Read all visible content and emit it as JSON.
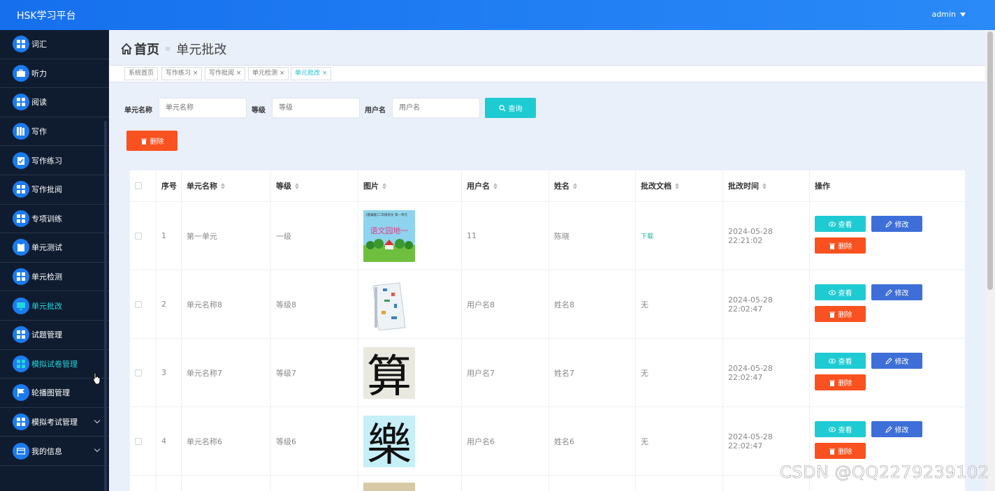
{
  "header": {
    "brand": "HSK学习平台",
    "user": "admin"
  },
  "sidebar": {
    "items": [
      {
        "label": "词汇",
        "icon": "grid-icon"
      },
      {
        "label": "听力",
        "icon": "briefcase-icon"
      },
      {
        "label": "阅读",
        "icon": "grid-icon"
      },
      {
        "label": "写作",
        "icon": "book-icon"
      },
      {
        "label": "写作练习",
        "icon": "clipboard-check-icon"
      },
      {
        "label": "写作批阅",
        "icon": "grid-icon"
      },
      {
        "label": "专项训练",
        "icon": "grid-icon"
      },
      {
        "label": "单元测试",
        "icon": "clipboard-icon"
      },
      {
        "label": "单元检测",
        "icon": "grid-icon"
      },
      {
        "label": "单元批改",
        "icon": "monitor-icon"
      },
      {
        "label": "试题管理",
        "icon": "grid-icon"
      },
      {
        "label": "模拟试卷管理",
        "icon": "grid-icon"
      },
      {
        "label": "轮播图管理",
        "icon": "flag-icon"
      },
      {
        "label": "模拟考试管理",
        "icon": "grid-icon"
      },
      {
        "label": "我的信息",
        "icon": "id-card-icon"
      }
    ]
  },
  "breadcrumb": {
    "home": "首页",
    "current": "单元批改"
  },
  "tags": [
    {
      "label": "系统首页",
      "closable": false
    },
    {
      "label": "写作练习",
      "closable": true
    },
    {
      "label": "写作批阅",
      "closable": true
    },
    {
      "label": "单元检测",
      "closable": true
    },
    {
      "label": "单元批改",
      "closable": true
    }
  ],
  "search": {
    "unit_label": "单元名称",
    "unit_placeholder": "单元名称",
    "level_label": "等级",
    "level_placeholder": "等级",
    "user_label": "用户名",
    "user_placeholder": "用户名",
    "query_button": "查询"
  },
  "toolbar": {
    "delete_button": "删除"
  },
  "table": {
    "columns": [
      "序号",
      "单元名称",
      "等级",
      "图片",
      "用户名",
      "姓名",
      "批改文档",
      "批改时间",
      "操作"
    ],
    "rows": [
      {
        "index": "1",
        "unit": "第一单元",
        "level": "一级",
        "image": "cover-yuwen",
        "user": "11",
        "name": "陈晓",
        "doc": "下载",
        "time": "2024-05-28 22:21:02"
      },
      {
        "index": "2",
        "unit": "单元名称8",
        "level": "等级8",
        "image": "cover-book",
        "user": "用户名8",
        "name": "姓名8",
        "doc": "无",
        "time": "2024-05-28 22:02:47"
      },
      {
        "index": "3",
        "unit": "单元名称7",
        "level": "等级7",
        "image": "char-suan",
        "user": "用户名7",
        "name": "姓名7",
        "doc": "无",
        "time": "2024-05-28 22:02:47"
      },
      {
        "index": "4",
        "unit": "单元名称6",
        "level": "等级6",
        "image": "char-le",
        "user": "用户名6",
        "name": "姓名6",
        "doc": "无",
        "time": "2024-05-28 22:02:47"
      }
    ],
    "actions": {
      "view": "查看",
      "edit": "修改",
      "delete": "删除"
    }
  },
  "image_text": {
    "yuwen_title": "语文园地一",
    "yuwen_sub": "[部编版]二年级语文 第一单元",
    "char_suan": "算",
    "char_le": "樂"
  },
  "watermark": "CSDN @QQ2279239102",
  "colors": {
    "topbar": "#1670ee",
    "sidebar": "#0f1c30",
    "active": "#23d5dc",
    "cyan": "#1fcbd3",
    "red": "#f9511f",
    "blue": "#3e6fd8"
  }
}
